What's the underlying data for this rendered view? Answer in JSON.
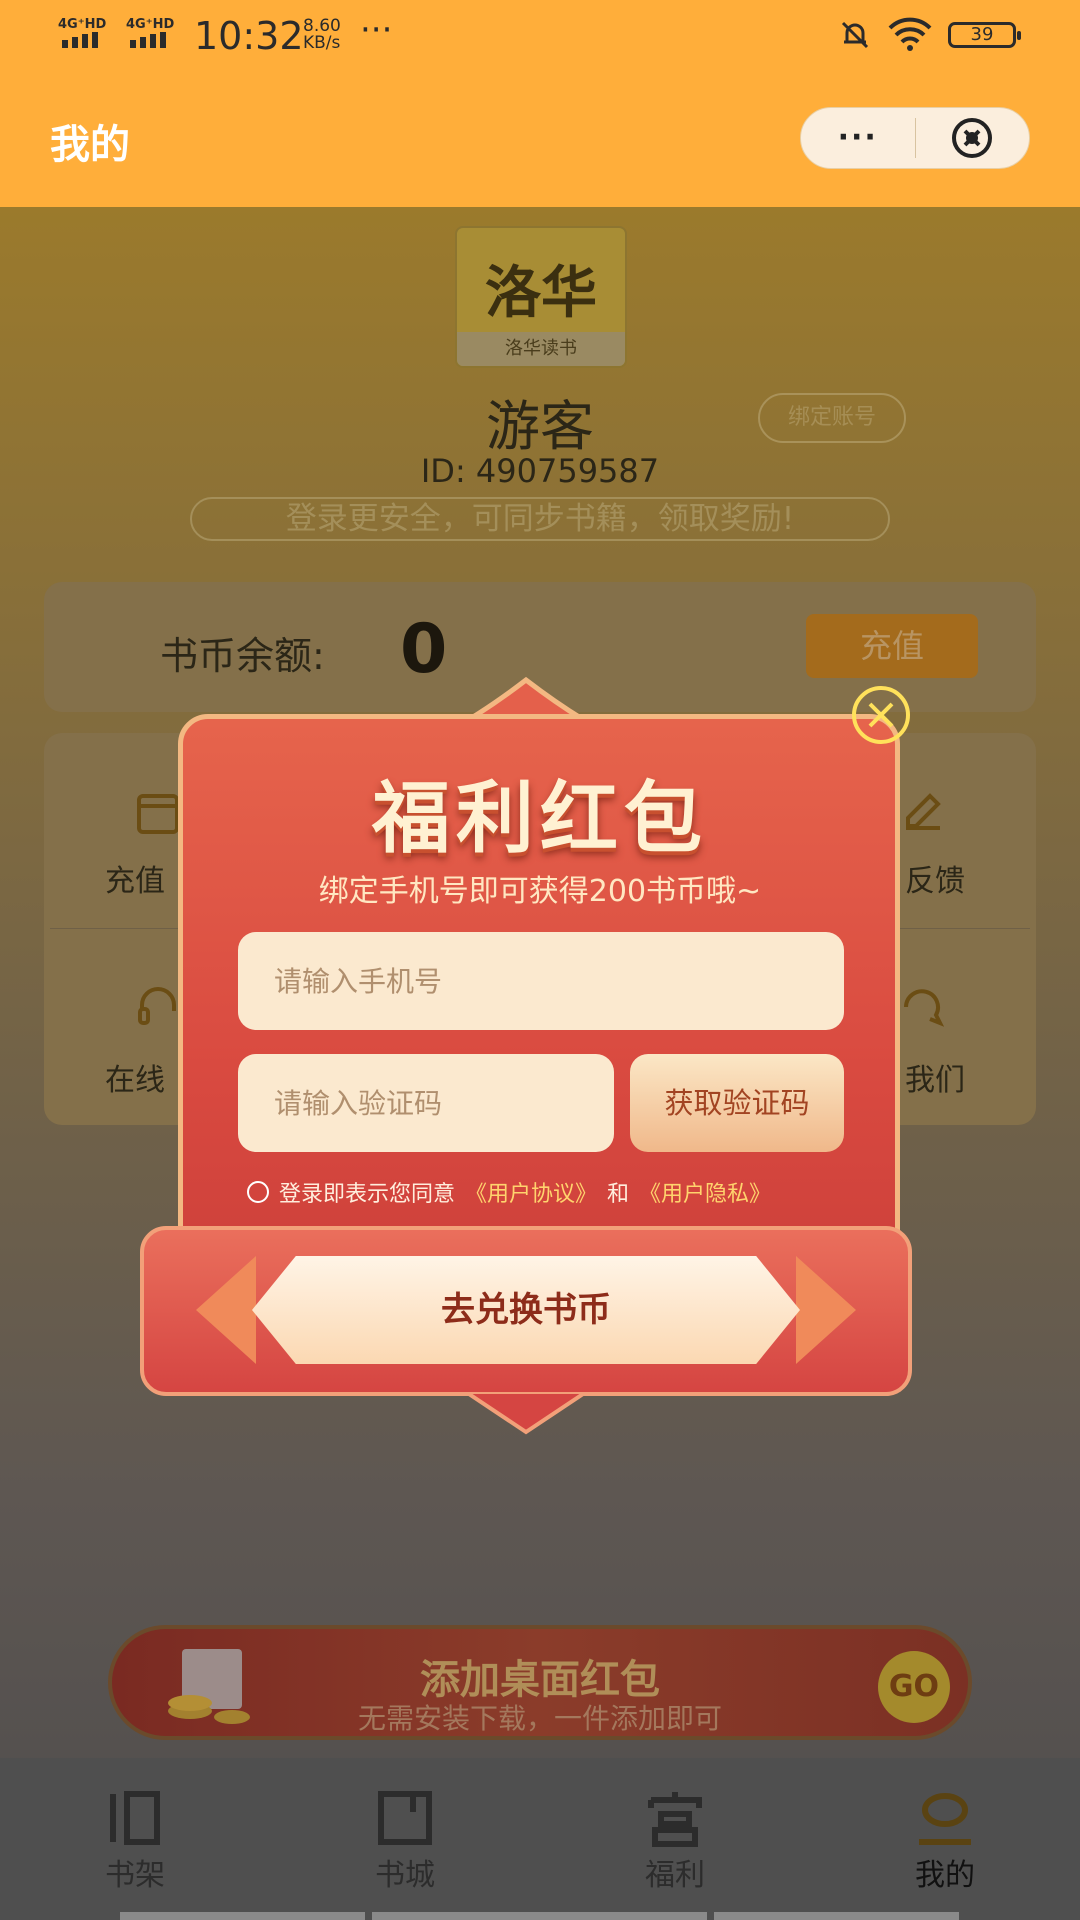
{
  "status_bar": {
    "network1": "4G⁺HD",
    "network2": "4G⁺HD",
    "time": "10:32",
    "speed_value": "8.60",
    "speed_unit": "KB/s",
    "more": "···",
    "battery": "39"
  },
  "nav": {
    "title": "我的",
    "more_label": "···"
  },
  "profile": {
    "logo_text": "洛华",
    "logo_subtext": "洛华读书",
    "name": "游客",
    "bind_button": "绑定账号",
    "id": "ID: 490759587",
    "hint": "登录更安全，可同步书籍，领取奖励!"
  },
  "balance": {
    "label": "书币余额:",
    "value": "0",
    "recharge_label": "充值"
  },
  "grid": {
    "item1": "充值",
    "item2": "反馈",
    "item3": "在线",
    "item4": "我们"
  },
  "modal": {
    "title": "福利红包",
    "subtitle": "绑定手机号即可获得200书币哦~",
    "phone_placeholder": "请输入手机号",
    "code_placeholder": "请输入验证码",
    "get_code": "获取验证码",
    "agree_text": "登录即表示您同意",
    "agreement_link": "《用户协议》",
    "and": "和",
    "privacy_link": "《用户隐私》",
    "cta": "去兑换书币"
  },
  "banner": {
    "title": "添加桌面红包",
    "subtitle": "无需安装下载，一件添加即可",
    "go": "GO"
  },
  "tabs": [
    {
      "label": "书架"
    },
    {
      "label": "书城"
    },
    {
      "label": "福利"
    },
    {
      "label": "我的"
    }
  ],
  "colors": {
    "header": "#ffae3a",
    "modal_red": "#d94a40",
    "accent_yellow": "#ffd36d"
  }
}
